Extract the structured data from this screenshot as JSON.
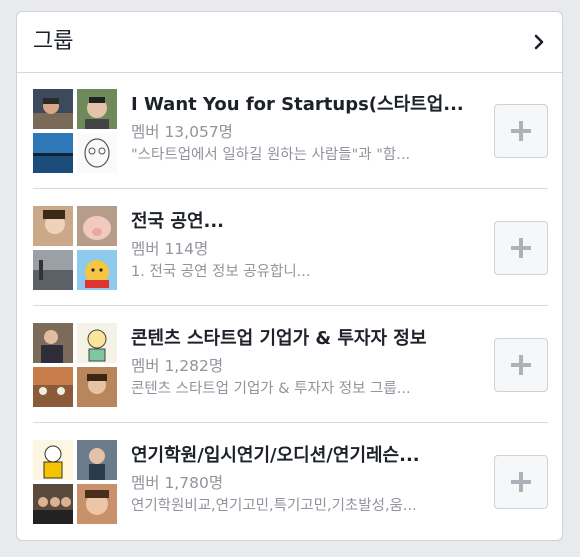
{
  "header": {
    "title": "그룹"
  },
  "groups": [
    {
      "name": "I Want You for Startups(스타트업...",
      "members": "멤버 13,057명",
      "description": "\"스타트업에서 일하길 원하는 사람들\"과 \"함..."
    },
    {
      "name": "전국 공연...",
      "members": "멤버 114명",
      "description": "1. 전국 공연 정보 공유합니..."
    },
    {
      "name": "콘텐츠 스타트업 기업가 & 투자자 정보",
      "members": "멤버 1,282명",
      "description": "콘텐츠 스타트업 기업가 & 투자자 정보 그룹..."
    },
    {
      "name": "연기학원/입시연기/오디션/연기레슨...",
      "members": "멤버 1,780명",
      "description": "연기학원비교,연기고민,특기고민,기초발성,움..."
    }
  ],
  "icons": {
    "header_chevron": "chevron-right-icon",
    "join": "plus-icon"
  },
  "colors": {
    "title_text": "#1d2129",
    "secondary_text": "#90949c",
    "divider": "#d6d8dc",
    "button_bg": "#f6f7f9",
    "plus_icon": "#aeb1b7"
  }
}
